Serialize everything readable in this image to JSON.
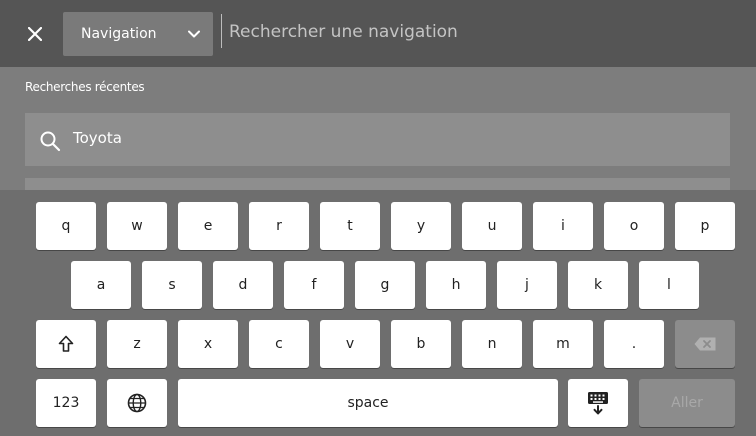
{
  "header": {
    "close_icon": "close-icon",
    "mode_label": "Navigation",
    "search_placeholder": "Rechercher une navigation"
  },
  "recent": {
    "title": "Recherches récentes",
    "items": [
      {
        "label": "Toyota"
      }
    ]
  },
  "keyboard": {
    "row1": [
      "q",
      "w",
      "e",
      "r",
      "t",
      "y",
      "u",
      "i",
      "o",
      "p"
    ],
    "row2": [
      "a",
      "s",
      "d",
      "f",
      "g",
      "h",
      "j",
      "k",
      "l"
    ],
    "row3": [
      "z",
      "x",
      "c",
      "v",
      "b",
      "n",
      "m",
      "."
    ],
    "numbers_label": "123",
    "space_label": "space",
    "go_label": "Aller",
    "icons": {
      "shift": "shift-icon",
      "backspace": "backspace-icon",
      "globe": "globe-icon",
      "hide_keyboard": "keyboard-hide-icon"
    }
  },
  "colors": {
    "header_bg": "#555555",
    "body_bg": "#7d7d7d",
    "keyboard_bg": "#6e6e6e",
    "key_bg": "#ffffff",
    "disabled_key_bg": "#8c8c8c"
  }
}
